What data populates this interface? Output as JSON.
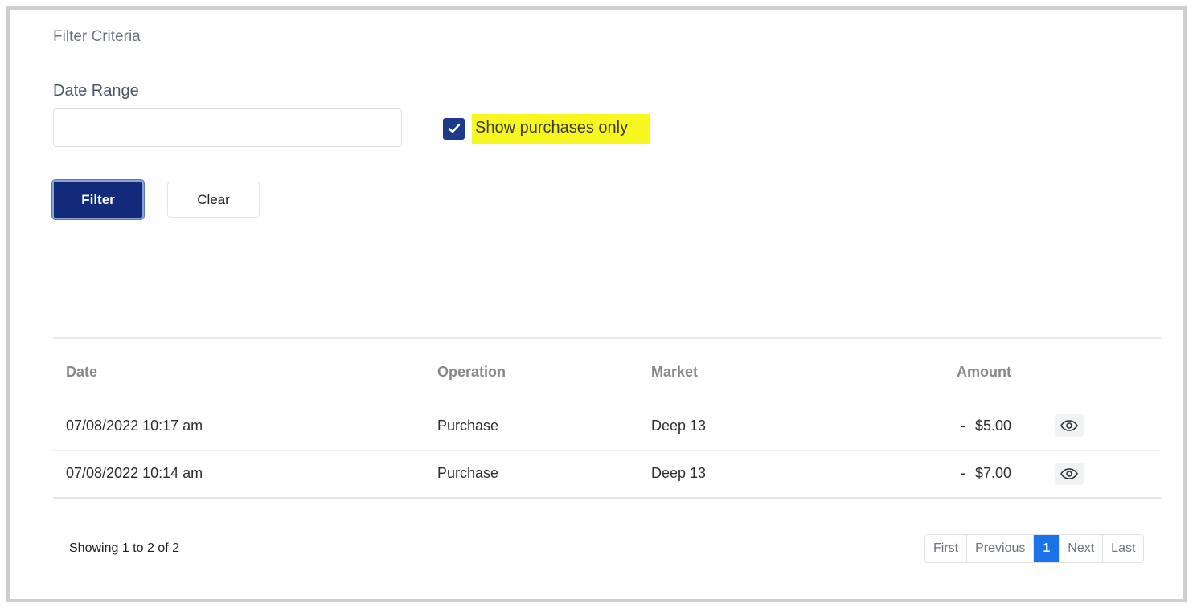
{
  "filter": {
    "section_title": "Filter Criteria",
    "date_range_label": "Date Range",
    "date_range_value": "",
    "show_purchases_only_label": "Show purchases only",
    "show_purchases_only_checked": true,
    "filter_button": "Filter",
    "clear_button": "Clear"
  },
  "table": {
    "columns": {
      "date": "Date",
      "operation": "Operation",
      "market": "Market",
      "amount": "Amount"
    },
    "rows": [
      {
        "date": "07/08/2022 10:17 am",
        "operation": "Purchase",
        "market": "Deep 13",
        "sign": "-",
        "amount": "$5.00"
      },
      {
        "date": "07/08/2022 10:14 am",
        "operation": "Purchase",
        "market": "Deep 13",
        "sign": "-",
        "amount": "$7.00"
      }
    ]
  },
  "footer": {
    "showing": "Showing 1 to 2 of 2",
    "pagination": {
      "first": "First",
      "previous": "Previous",
      "current": "1",
      "next": "Next",
      "last": "Last"
    }
  },
  "colors": {
    "primary": "#13297a",
    "highlight": "#f7f71f",
    "active_page": "#1a73e8"
  },
  "icons": {
    "checkbox": "check-icon",
    "view": "eye-icon"
  }
}
